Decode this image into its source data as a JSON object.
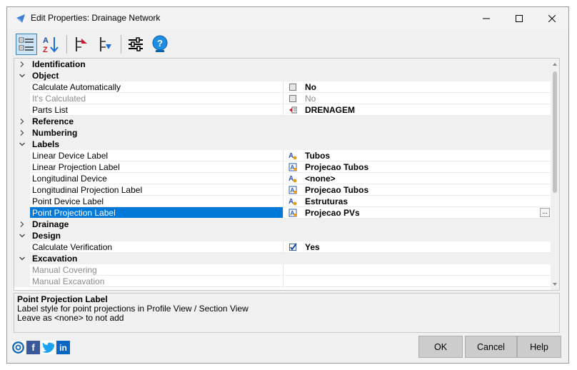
{
  "window": {
    "title": "Edit Properties: Drainage Network"
  },
  "toolbar": {
    "buttons": [
      {
        "name": "categorized-view",
        "icon": "categorized-list-icon"
      },
      {
        "name": "sort-alphabetical",
        "icon": "sort-az-icon"
      },
      {
        "name": "move-up",
        "icon": "move-up-icon"
      },
      {
        "name": "move-down",
        "icon": "move-down-icon"
      },
      {
        "name": "settings",
        "icon": "sliders-icon"
      },
      {
        "name": "help",
        "icon": "help-icon"
      }
    ]
  },
  "grid": {
    "rows": [
      {
        "type": "category",
        "label": "Identification",
        "expanded": false
      },
      {
        "type": "category",
        "label": "Object",
        "expanded": true
      },
      {
        "type": "property",
        "name": "Calculate Automatically",
        "value": "No",
        "icon": "checkbox-icon"
      },
      {
        "type": "property",
        "name": "It's Calculated",
        "value": "No",
        "icon": "checkbox-icon",
        "disabled": true
      },
      {
        "type": "property",
        "name": "Parts List",
        "value": "DRENAGEM",
        "icon": "parts-list-icon"
      },
      {
        "type": "category",
        "label": "Reference",
        "expanded": false
      },
      {
        "type": "category",
        "label": "Numbering",
        "expanded": false
      },
      {
        "type": "category",
        "label": "Labels",
        "expanded": true
      },
      {
        "type": "property",
        "name": "Linear Device Label",
        "value": "Tubos",
        "icon": "label-style-icon"
      },
      {
        "type": "property",
        "name": "Linear Projection Label",
        "value": "Projecao Tubos",
        "icon": "projection-label-icon"
      },
      {
        "type": "property",
        "name": "Longitudinal Device",
        "value": "<none>",
        "icon": "label-style-icon"
      },
      {
        "type": "property",
        "name": "Longitudinal Projection Label",
        "value": "Projecao Tubos",
        "icon": "projection-label-icon"
      },
      {
        "type": "property",
        "name": "Point Device Label",
        "value": "Estruturas",
        "icon": "label-style-icon"
      },
      {
        "type": "property",
        "name": "Point Projection Label",
        "value": "Projecao PVs",
        "icon": "projection-label-icon",
        "selected": true,
        "button": "..."
      },
      {
        "type": "category",
        "label": "Drainage",
        "expanded": false
      },
      {
        "type": "category",
        "label": "Design",
        "expanded": true
      },
      {
        "type": "property",
        "name": "Calculate Verification",
        "value": "Yes",
        "icon": "checked-box-icon"
      },
      {
        "type": "category",
        "label": "Excavation",
        "expanded": true
      },
      {
        "type": "property",
        "name": "Manual Covering",
        "value": "",
        "disabled": true
      },
      {
        "type": "property",
        "name": "Manual Excavation",
        "value": "",
        "disabled": true
      }
    ]
  },
  "description": {
    "title": "Point Projection Label",
    "line1": "Label style for point projections in Profile View / Section View",
    "line2": "Leave as <none> to not add"
  },
  "social": [
    {
      "name": "website",
      "icon": "globe-icon",
      "color": "#1f6fb5"
    },
    {
      "name": "facebook",
      "icon": "facebook-icon",
      "color": "#3b5998",
      "glyph": "f"
    },
    {
      "name": "twitter",
      "icon": "twitter-icon",
      "color": "#1da1f2"
    },
    {
      "name": "linkedin",
      "icon": "linkedin-icon",
      "color": "#0a66c2",
      "glyph": "in"
    }
  ],
  "buttons": {
    "ok": "OK",
    "cancel": "Cancel",
    "help": "Help"
  },
  "colors": {
    "selection": "#0078d7",
    "category_bg": "#f0f0f0"
  }
}
